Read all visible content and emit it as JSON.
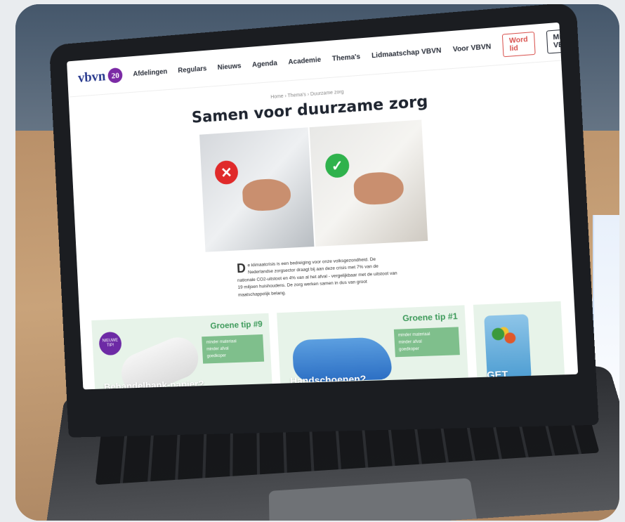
{
  "site": {
    "logo_text": "vbvn",
    "logo_badge": "20",
    "nav_links": [
      "Afdelingen",
      "Regulars",
      "Nieuws",
      "Agenda",
      "Academie",
      "Thema's",
      "Lidmaatschap VBVN",
      "Voor VBVN"
    ],
    "button_primary": "Word lid",
    "button_secondary": "Mijn VBVN"
  },
  "page": {
    "breadcrumb": "Home › Thema's › Duurzame zorg",
    "title": "Samen voor duurzame zorg",
    "intro": "e klimaatcrisis is een bedreiging voor onze volksgezondheid. De Nederlandse zorgsector draagt bij aan deze crisis met 7% van de nationale CO2-uitstoot en 4% van al het afval - vergelijkbaar met de uitstoot van 19 miljoen huishoudens. De zorg werken samen in dus van groot maatschappelijk belang.",
    "dropcap": "D"
  },
  "cards": [
    {
      "badge": "NIEUWE TIP!",
      "tip": "Groene tip #9",
      "list": [
        "minder materiaal",
        "minder afval",
        "goedkoper"
      ],
      "heading": "Behandelbank-papier?"
    },
    {
      "tip": "Groene tip #1",
      "list": [
        "minder materiaal",
        "minder afval",
        "goedkoper"
      ],
      "heading": "Handschoenen?"
    },
    {
      "heading": "GET"
    }
  ],
  "icons": {
    "cross": "✕",
    "check": "✓",
    "search": "search-icon"
  }
}
